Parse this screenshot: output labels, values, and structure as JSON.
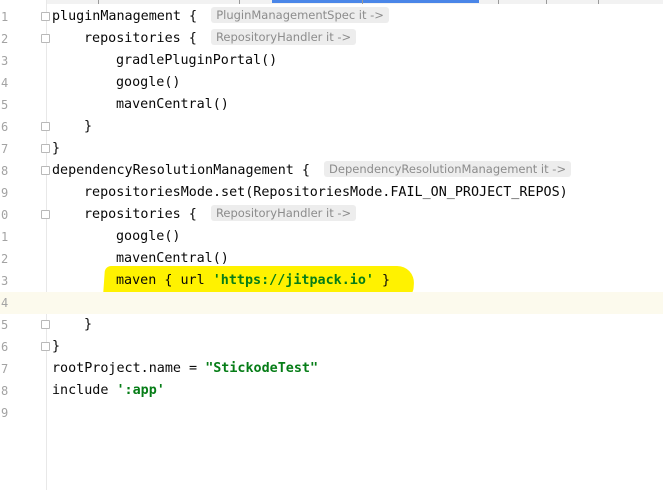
{
  "editor": {
    "lines": [
      {
        "n": "1",
        "fold": true,
        "indent": 0,
        "parts": [
          {
            "t": "pluginManagement { ",
            "c": "kw"
          }
        ],
        "hint": "PluginManagementSpec it ->"
      },
      {
        "n": "2",
        "fold": true,
        "indent": 1,
        "parts": [
          {
            "t": "repositories { ",
            "c": "kw"
          }
        ],
        "hint": "RepositoryHandler it ->"
      },
      {
        "n": "3",
        "fold": false,
        "indent": 2,
        "parts": [
          {
            "t": "gradlePluginPortal()",
            "c": "kw"
          }
        ]
      },
      {
        "n": "4",
        "fold": false,
        "indent": 2,
        "parts": [
          {
            "t": "google()",
            "c": "kw"
          }
        ]
      },
      {
        "n": "5",
        "fold": false,
        "indent": 2,
        "parts": [
          {
            "t": "mavenCentral()",
            "c": "kw"
          }
        ]
      },
      {
        "n": "6",
        "fold": true,
        "indent": 1,
        "parts": [
          {
            "t": "}",
            "c": "kw"
          }
        ]
      },
      {
        "n": "7",
        "fold": true,
        "indent": 0,
        "parts": [
          {
            "t": "}",
            "c": "kw"
          }
        ]
      },
      {
        "n": "8",
        "fold": true,
        "indent": 0,
        "parts": [
          {
            "t": "dependencyResolutionManagement { ",
            "c": "kw"
          }
        ],
        "hint": "DependencyResolutionManagement it ->"
      },
      {
        "n": "9",
        "fold": false,
        "indent": 1,
        "parts": [
          {
            "t": "repositoriesMode.set(RepositoriesMode.FAIL_ON_PROJECT_REPOS)",
            "c": "kw"
          }
        ]
      },
      {
        "n": "0",
        "fold": true,
        "indent": 1,
        "parts": [
          {
            "t": "repositories { ",
            "c": "kw"
          }
        ],
        "hint": "RepositoryHandler it ->"
      },
      {
        "n": "1",
        "fold": false,
        "indent": 2,
        "parts": [
          {
            "t": "google()",
            "c": "kw"
          }
        ]
      },
      {
        "n": "2",
        "fold": false,
        "indent": 2,
        "parts": [
          {
            "t": "mavenCentral()",
            "c": "kw"
          }
        ]
      },
      {
        "n": "3",
        "fold": false,
        "indent": 2,
        "parts": [
          {
            "t": "maven { url ",
            "c": "kw"
          },
          {
            "t": "'https://jitpack.io'",
            "c": "str"
          },
          {
            "t": " }",
            "c": "kw"
          }
        ]
      },
      {
        "n": "4",
        "fold": false,
        "indent": 0,
        "current": true,
        "parts": []
      },
      {
        "n": "5",
        "fold": true,
        "indent": 1,
        "parts": [
          {
            "t": "}",
            "c": "kw"
          }
        ]
      },
      {
        "n": "6",
        "fold": true,
        "indent": 0,
        "parts": [
          {
            "t": "}",
            "c": "kw"
          }
        ]
      },
      {
        "n": "7",
        "fold": false,
        "indent": 0,
        "parts": [
          {
            "t": "rootProject.name = ",
            "c": "kw"
          },
          {
            "t": "\"StickodeTest\"",
            "c": "str"
          }
        ]
      },
      {
        "n": "8",
        "fold": false,
        "indent": 0,
        "parts": [
          {
            "t": "include ",
            "c": "kw"
          },
          {
            "t": "':app'",
            "c": "str"
          }
        ]
      },
      {
        "n": "9",
        "fold": false,
        "indent": 0,
        "parts": []
      }
    ]
  }
}
